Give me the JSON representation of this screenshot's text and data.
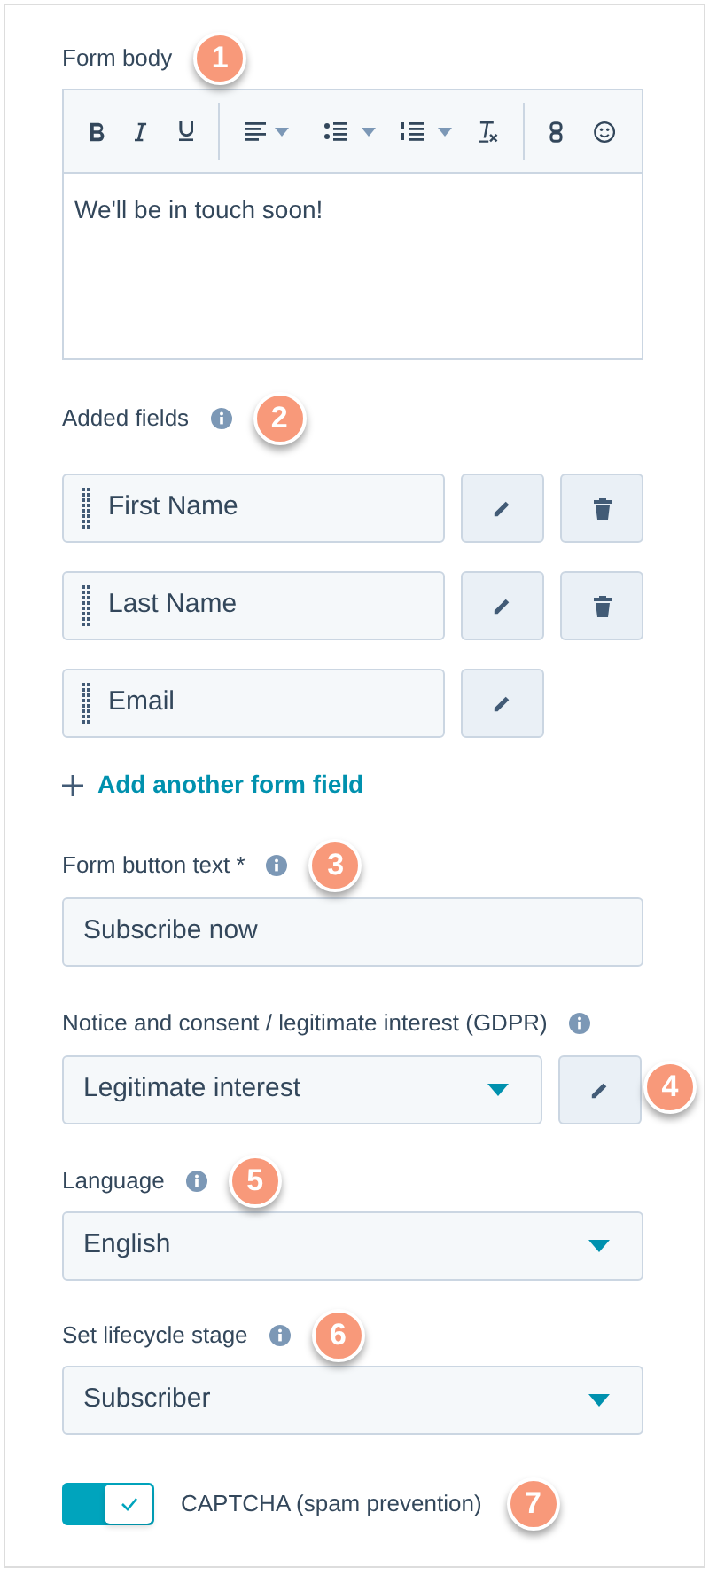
{
  "form_body": {
    "label": "Form body",
    "info": false,
    "callout": "1",
    "body": "We'll be in touch soon!"
  },
  "added_fields": {
    "label": "Added fields",
    "info": true,
    "callout": "2",
    "fields": [
      {
        "label": "First Name",
        "deletable": true
      },
      {
        "label": "Last Name",
        "deletable": true
      },
      {
        "label": "Email",
        "deletable": false
      }
    ],
    "add_link": "Add another form field"
  },
  "button_text": {
    "label": "Form button text *",
    "info": true,
    "callout": "3",
    "value": "Subscribe now"
  },
  "gdpr": {
    "label": "Notice and consent / legitimate interest (GDPR)",
    "info": true,
    "value": "Legitimate interest",
    "edit_callout": "4"
  },
  "language": {
    "label": "Language",
    "info": true,
    "callout": "5",
    "value": "English"
  },
  "lifecycle": {
    "label": "Set lifecycle stage",
    "info": true,
    "callout": "6",
    "value": "Subscriber"
  },
  "captcha": {
    "label": "CAPTCHA (spam prevention)",
    "on": true,
    "callout": "7"
  }
}
